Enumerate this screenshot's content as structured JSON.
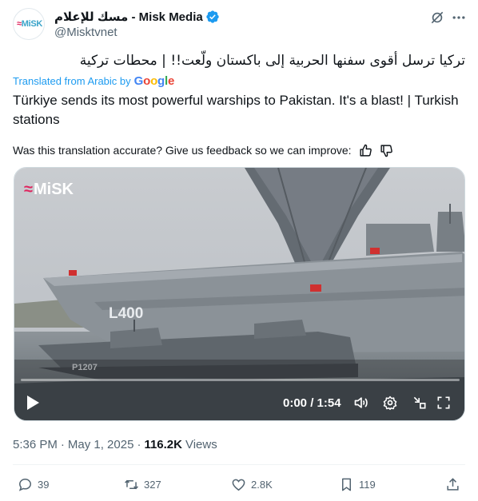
{
  "author": {
    "display_name": "مسك للإعلام - Misk Media",
    "handle": "@Misktvnet",
    "avatar_logo": "MiSK",
    "verified": true
  },
  "tweet": {
    "original_text": "تركيا ترسل أقوى سفنها الحربية إلى باكستان ولّعت!! | محطات تركية",
    "translated_from": "Translated from Arabic by",
    "translator": "Google",
    "translation_text": "Türkiye sends its most powerful warships to Pakistan. It's a blast! | Turkish stations",
    "feedback_prompt": "Was this translation accurate? Give us feedback so we can improve:"
  },
  "video": {
    "watermark": "MiSK",
    "ship_label_large": "L400",
    "ship_label_small": "P1207",
    "current_time": "0:00 / 1:54",
    "progress": 0.0
  },
  "meta": {
    "time": "5:36 PM",
    "separator": "·",
    "date": "May 1, 2025",
    "views_count": "116.2K",
    "views_label": "Views"
  },
  "actions": {
    "replies": "39",
    "reposts": "327",
    "likes": "2.8K",
    "bookmarks": "119"
  },
  "colors": {
    "accent": "#1d9bf0",
    "text_primary": "#0f1419",
    "text_secondary": "#536471",
    "verified": "#1d9bf0"
  },
  "icons": [
    "verified-badge-icon",
    "grok-icon",
    "more-icon",
    "thumbs-up-icon",
    "thumbs-down-icon",
    "play-icon",
    "volume-icon",
    "settings-icon",
    "minimize-icon",
    "fullscreen-icon",
    "reply-icon",
    "repost-icon",
    "like-icon",
    "bookmark-icon",
    "share-icon"
  ]
}
